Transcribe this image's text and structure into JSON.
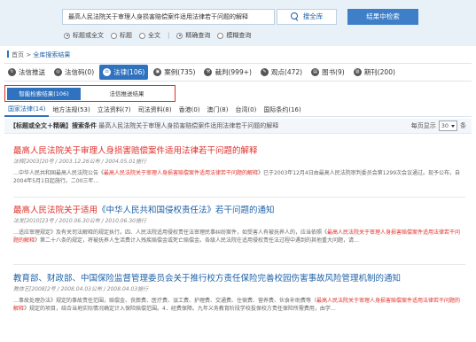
{
  "search": {
    "query": "最高人民法院关于审理人身损害赔偿案件适用法律若干问题的解释",
    "search_button": "搜全库",
    "advanced_button": "结果中检索",
    "options": [
      {
        "label": "标题或全文",
        "checked": true
      },
      {
        "label": "标题",
        "checked": false
      },
      {
        "label": "全文",
        "checked": false
      },
      {
        "label": "精确查询",
        "checked": true
      },
      {
        "label": "模糊查询",
        "checked": false
      }
    ]
  },
  "breadcrumb": {
    "home": "首页",
    "sep": ">",
    "current": "全库搜索结果"
  },
  "categories": [
    {
      "label": "法信推送",
      "icon": "push-icon",
      "glyph": "↻"
    },
    {
      "label": "法信码(0)",
      "icon": "code-icon",
      "glyph": "◎"
    },
    {
      "label": "法律(106)",
      "icon": "law-icon",
      "glyph": "⚖"
    },
    {
      "label": "案例(735)",
      "icon": "case-icon",
      "glyph": "▣"
    },
    {
      "label": "裁判(999+)",
      "icon": "judgment-icon",
      "glyph": "⚒"
    },
    {
      "label": "观点(472)",
      "icon": "opinion-icon",
      "glyph": "✎"
    },
    {
      "label": "图书(9)",
      "icon": "book-icon",
      "glyph": "▤"
    },
    {
      "label": "期刊(200)",
      "icon": "journal-icon",
      "glyph": "▥"
    }
  ],
  "subtabs": [
    "智能检索结果(106)",
    "法信推送结果"
  ],
  "libraries": [
    "国家法律(14)",
    "地方法规(53)",
    "立法资料(7)",
    "司法资料(8)",
    "香港(0)",
    "澳门(8)",
    "台湾(0)",
    "国际条约(16)"
  ],
  "conditions": {
    "label": "【标题或全文＋精确】搜索条件",
    "value": "最高人民法院关于审理人身损害赔偿案件适用法律若干问题的解释",
    "per_page_label": "每页显示",
    "per_page_value": "30",
    "per_page_unit": "条"
  },
  "results": [
    {
      "title_hl": "最高人民法院关于审理人身损害赔偿案件适用法律若干问题的解释",
      "title_rest": "",
      "meta": "法释[2003]20号 / 2003.12.26公布 / 2004.05.01施行",
      "snippet": [
        {
          "t": "…中华人民共和国最高人民法院公告《",
          "hl": false
        },
        {
          "t": "最高人民法院关于审理人身损害赔偿案件适用法律若干问题的解释",
          "hl": true
        },
        {
          "t": "》已于2003年12月4日由最高人民法院审判委员会第1299次会议通过。现予公布，自2004年5月1日起施行。二00三年…",
          "hl": false
        }
      ]
    },
    {
      "title_hl": "最高人民法院关于适用",
      "title_rest": "《中华人民共和国侵权责任法》若干问题的通知",
      "meta": "法发[2010]23号 / 2010.06.30公布 / 2010.06.30施行",
      "snippet": [
        {
          "t": "…适应审理规定》及有关司法解释的规定执行。四、人民法院适用侵权责任法审理民事纠纷案件，如受害人有被抚养人的，应当依照《",
          "hl": false
        },
        {
          "t": "最高人民法院关于审理人身损害赔偿案件适用法律若干问题的解释",
          "hl": true
        },
        {
          "t": "》第二十八条的规定，将被抚养人生活费计入残疾赔偿金或死亡赔偿金。各级人民法院在适用侵权责任法过程中遇到的其他重大问题，请…",
          "hl": false
        }
      ]
    },
    {
      "title_hl": "",
      "title_rest": "教育部、财政部、中国保险监督管理委员会关于推行校方责任保险完善校园伤害事故风险管理机制的通知",
      "meta": "教体艺[2008]2号 / 2008.04.03公布 / 2008.04.03施行",
      "snippet": [
        {
          "t": "…事故处理办法》规定的事故责任范围，赔偿金、丧葬费、医疗费、误工费、护理费、交通费、住宿费、营养费、伙食补助费等（",
          "hl": false
        },
        {
          "t": "最高人民法院关于审理人身损害赔偿案件适用法律若干问题的解释",
          "hl": true
        },
        {
          "t": "》规定的项目，结合当地实际情况确定计入保险赔偿范围。4．经费保障。九年义务教育阶段学校投保校方责任保险所需费用，由学…",
          "hl": false
        }
      ]
    }
  ]
}
